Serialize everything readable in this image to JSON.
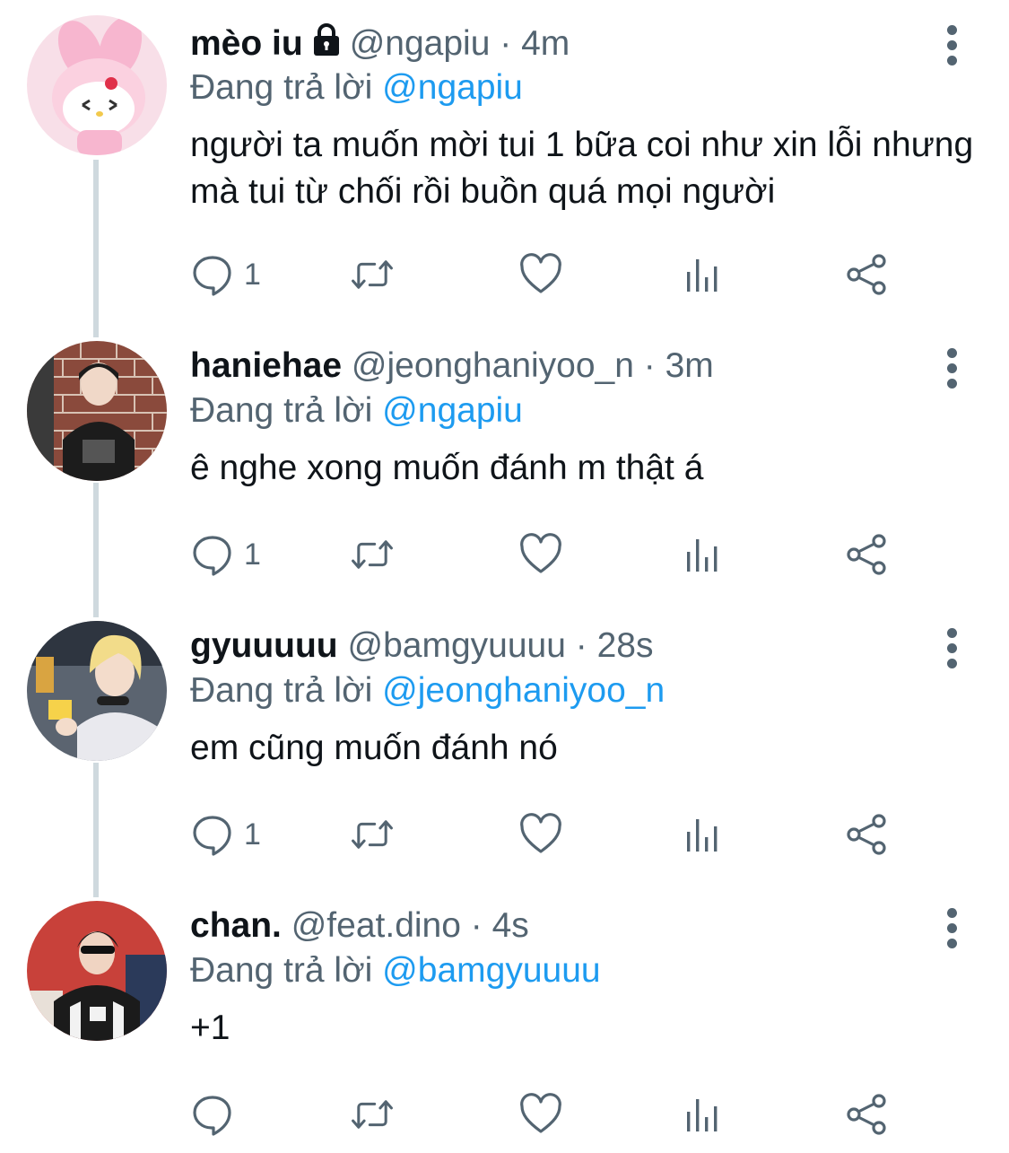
{
  "replying_label": "Đang trả lời",
  "colors": {
    "link": "#1d9bf0",
    "muted": "#536471",
    "text": "#0f1419",
    "thread_line": "#cfd9de"
  },
  "tweets": [
    {
      "name": "mèo iu",
      "protected": true,
      "handle": "@ngapiu",
      "time": "4m",
      "reply_to": "@ngapiu",
      "text": "người ta muốn mời tui 1 bữa coi như xin lỗi nhưng mà tui từ chối rồi buồn quá mọi người",
      "reply_count": "1",
      "avatar_icon": "pink-bunny-avatar"
    },
    {
      "name": "haniehae",
      "protected": false,
      "handle": "@jeonghaniyoo_n",
      "time": "3m",
      "reply_to": "@ngapiu",
      "text": "ê nghe xong muốn đánh m thật á",
      "reply_count": "1",
      "avatar_icon": "person-brick-wall-avatar"
    },
    {
      "name": "gyuuuuu",
      "protected": false,
      "handle": "@bamgyuuuu",
      "time": "28s",
      "reply_to": "@jeonghaniyoo_n",
      "text": "em cũng muốn đánh nó",
      "reply_count": "1",
      "avatar_icon": "blonde-person-avatar"
    },
    {
      "name": "chan.",
      "protected": false,
      "handle": "@feat.dino",
      "time": "4s",
      "reply_to": "@bamgyuuuu",
      "text": "+1",
      "reply_count": "",
      "avatar_icon": "person-jacket-avatar"
    }
  ]
}
